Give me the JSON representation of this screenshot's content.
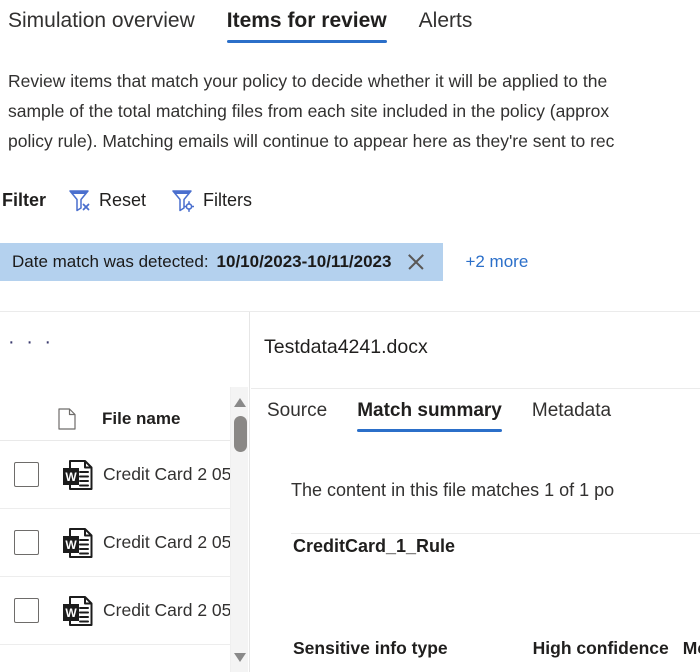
{
  "tabs": [
    {
      "label": "Simulation overview",
      "selected": false
    },
    {
      "label": "Items for review",
      "selected": true
    },
    {
      "label": "Alerts",
      "selected": false
    }
  ],
  "description": "Review items that match your policy to decide whether it will be applied to the\nsample of the total matching files from each site included in the policy (approx\npolicy rule). Matching emails will continue to appear here as they're sent to rec",
  "filter_bar": {
    "label": "Filter",
    "reset_label": "Reset",
    "reset_icon": "funnel-clear-icon",
    "filters_label": "Filters",
    "filters_icon": "funnel-settings-icon"
  },
  "applied_filters": {
    "chip_label": "Date match was detected:",
    "chip_value": "10/10/2023-10/11/2023",
    "chip_close_icon": "close-icon",
    "more_label": "+2 more",
    "chip_background": "#b4d1ee"
  },
  "file_list": {
    "overflow_label": "· · ·",
    "header": {
      "icon": "document-icon",
      "label": "File name"
    },
    "rows": [
      {
        "icon": "word-document-icon",
        "name": "Credit Card 2 05"
      },
      {
        "icon": "word-document-icon",
        "name": "Credit Card 2 05"
      },
      {
        "icon": "word-document-icon",
        "name": "Credit Card 2 05"
      }
    ],
    "scrollbar": {
      "up_icon": "scroll-up-arrow-icon",
      "down_icon": "scroll-down-arrow-icon"
    }
  },
  "detail": {
    "title": "Testdata4241.docx",
    "tabs": [
      {
        "label": "Source",
        "selected": false
      },
      {
        "label": "Match summary",
        "selected": true
      },
      {
        "label": "Metadata",
        "selected": false
      }
    ],
    "match_sentence": "The content in this file matches 1 of 1 po",
    "rule_name": "CreditCard_1_Rule",
    "table_headers": [
      "Sensitive info type",
      "High confidence",
      "Mediur"
    ]
  },
  "colors": {
    "accent": "#2b6fc9",
    "link": "#2b6fc9",
    "text": "#201f1e"
  }
}
